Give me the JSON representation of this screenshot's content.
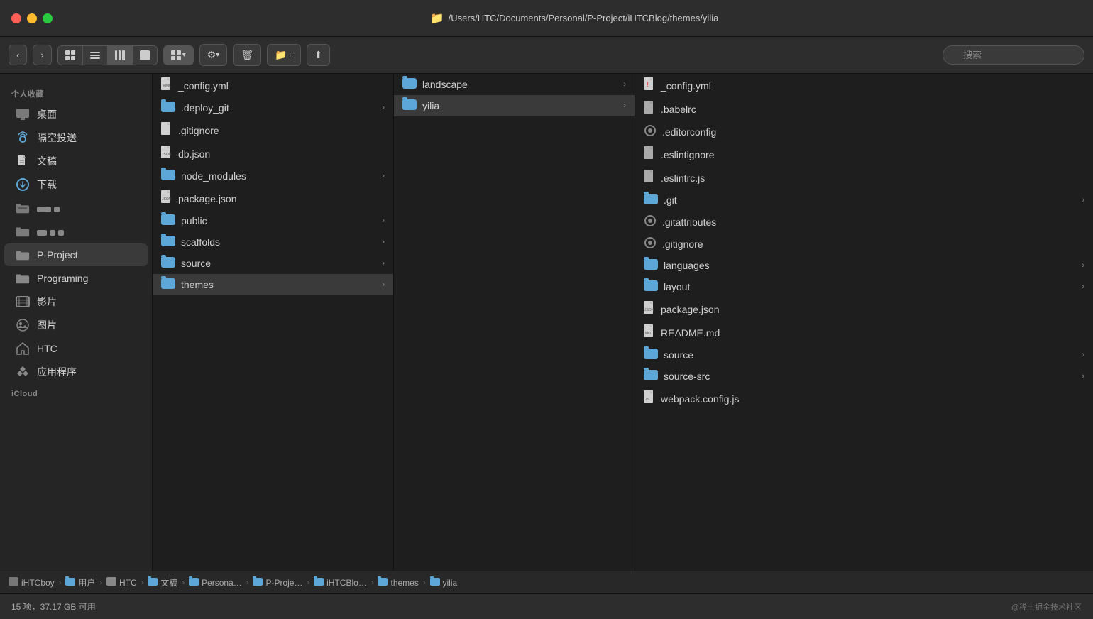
{
  "titleBar": {
    "path": "/Users/HTC/Documents/Personal/P-Project/iHTCBlog/themes/yilia"
  },
  "toolbar": {
    "backLabel": "←",
    "forwardLabel": "→",
    "viewModes": [
      "grid",
      "list",
      "column",
      "cover"
    ],
    "activeView": "column",
    "searchPlaceholder": "搜索"
  },
  "sidebar": {
    "sectionLabel": "个人收藏",
    "items": [
      {
        "id": "desktop",
        "label": "桌面",
        "iconType": "grid"
      },
      {
        "id": "airdrop",
        "label": "隔空投送",
        "iconType": "airdrop"
      },
      {
        "id": "documents",
        "label": "文稿",
        "iconType": "doc"
      },
      {
        "id": "downloads",
        "label": "下载",
        "iconType": "download"
      },
      {
        "id": "folder1",
        "label": "",
        "iconType": "folder-gray",
        "hasSubfolders": true
      },
      {
        "id": "folder2",
        "label": "",
        "iconType": "folder-gray",
        "hasSubfolders": true
      },
      {
        "id": "p-project",
        "label": "P-Project",
        "iconType": "folder-gray",
        "active": true
      },
      {
        "id": "programing",
        "label": "Programing",
        "iconType": "folder-gray"
      },
      {
        "id": "movies",
        "label": "影片",
        "iconType": "film"
      },
      {
        "id": "photos",
        "label": "图片",
        "iconType": "photo"
      },
      {
        "id": "htc",
        "label": "HTC",
        "iconType": "home"
      },
      {
        "id": "apps",
        "label": "应用程序",
        "iconType": "apps"
      },
      {
        "id": "icloud",
        "label": "iCloud",
        "iconType": "cloud"
      }
    ]
  },
  "columns": {
    "col1": {
      "items": [
        {
          "id": "config-yml",
          "name": "_config.yml",
          "type": "file-yaml",
          "selected": false
        },
        {
          "id": "deploy-git",
          "name": ".deploy_git",
          "type": "folder",
          "hasArrow": true
        },
        {
          "id": "gitignore",
          "name": ".gitignore",
          "type": "file",
          "selected": false
        },
        {
          "id": "db-json",
          "name": "db.json",
          "type": "file",
          "selected": false
        },
        {
          "id": "node-modules",
          "name": "node_modules",
          "type": "folder",
          "hasArrow": true
        },
        {
          "id": "package-json",
          "name": "package.json",
          "type": "file",
          "selected": false
        },
        {
          "id": "public",
          "name": "public",
          "type": "folder",
          "hasArrow": true
        },
        {
          "id": "scaffolds",
          "name": "scaffolds",
          "type": "folder",
          "hasArrow": true
        },
        {
          "id": "source",
          "name": "source",
          "type": "folder",
          "hasArrow": true
        },
        {
          "id": "themes",
          "name": "themes",
          "type": "folder",
          "hasArrow": true,
          "selected": true
        }
      ]
    },
    "col2": {
      "items": [
        {
          "id": "landscape",
          "name": "landscape",
          "type": "folder",
          "hasArrow": true
        },
        {
          "id": "yilia",
          "name": "yilia",
          "type": "folder",
          "hasArrow": true,
          "selected": true
        }
      ]
    },
    "col3": {
      "items": [
        {
          "id": "c3-config-yml",
          "name": "_config.yml",
          "type": "file-exclaim"
        },
        {
          "id": "c3-babelrc",
          "name": ".babelrc",
          "type": "file"
        },
        {
          "id": "c3-editorconfig",
          "name": ".editorconfig",
          "type": "file-gear"
        },
        {
          "id": "c3-eslintignore",
          "name": ".eslintignore",
          "type": "file"
        },
        {
          "id": "c3-eslintrc",
          "name": ".eslintrc.js",
          "type": "file"
        },
        {
          "id": "c3-git",
          "name": ".git",
          "type": "folder",
          "hasArrow": true
        },
        {
          "id": "c3-gitattributes",
          "name": ".gitattributes",
          "type": "file-gear"
        },
        {
          "id": "c3-gitignore",
          "name": ".gitignore",
          "type": "file-gear"
        },
        {
          "id": "c3-languages",
          "name": "languages",
          "type": "folder",
          "hasArrow": true
        },
        {
          "id": "c3-layout",
          "name": "layout",
          "type": "folder",
          "hasArrow": true
        },
        {
          "id": "c3-package-json",
          "name": "package.json",
          "type": "file"
        },
        {
          "id": "c3-readme",
          "name": "README.md",
          "type": "file"
        },
        {
          "id": "c3-source",
          "name": "source",
          "type": "folder",
          "hasArrow": true
        },
        {
          "id": "c3-source-src",
          "name": "source-src",
          "type": "folder",
          "hasArrow": true
        },
        {
          "id": "c3-webpack",
          "name": "webpack.config.js",
          "type": "file"
        }
      ]
    }
  },
  "breadcrumb": {
    "items": [
      {
        "id": "drive",
        "label": "iHTCboy",
        "iconType": "drive"
      },
      {
        "id": "sep1",
        "label": "›"
      },
      {
        "id": "user",
        "label": "用户",
        "iconType": "folder"
      },
      {
        "id": "sep2",
        "label": "›"
      },
      {
        "id": "htc",
        "label": "HTC",
        "iconType": "home"
      },
      {
        "id": "sep3",
        "label": "›"
      },
      {
        "id": "wenzhao",
        "label": "文稿",
        "iconType": "folder"
      },
      {
        "id": "sep4",
        "label": "›"
      },
      {
        "id": "personal",
        "label": "Persona…",
        "iconType": "folder"
      },
      {
        "id": "sep5",
        "label": "›"
      },
      {
        "id": "pproject",
        "label": "P-Proje…",
        "iconType": "folder"
      },
      {
        "id": "sep6",
        "label": "›"
      },
      {
        "id": "ihtcblog",
        "label": "iHTCBlo…",
        "iconType": "folder"
      },
      {
        "id": "sep7",
        "label": "›"
      },
      {
        "id": "themes",
        "label": "themes",
        "iconType": "folder"
      },
      {
        "id": "sep8",
        "label": "›"
      },
      {
        "id": "yilia",
        "label": "yilia",
        "iconType": "folder"
      }
    ]
  },
  "statusBar": {
    "itemCount": "15 项，37.17 GB 可用",
    "watermark": "@稀土掘金技术社区"
  }
}
